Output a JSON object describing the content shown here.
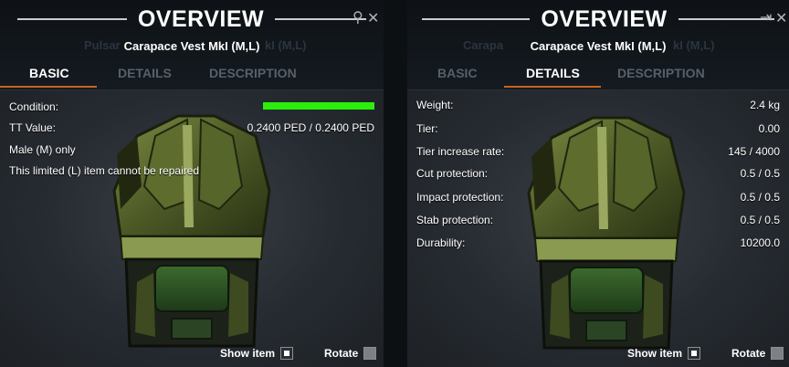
{
  "left_window": {
    "title": "OVERVIEW",
    "subtitle": "Carapace Vest MkI (M,L)",
    "ghost_subtitle": "Pulsar",
    "ghost_subtitle_right": "kI (M,L)",
    "controls": {
      "pin_icon": "pin-icon",
      "close_icon": "close-icon",
      "close_glyph": "✕",
      "pin_glyph": "⚲"
    },
    "tabs": [
      {
        "label": "BASIC",
        "active": true
      },
      {
        "label": "DETAILS",
        "active": false
      },
      {
        "label": "DESCRIPTION",
        "active": false
      }
    ],
    "rows": [
      {
        "label": "Condition:",
        "value": ""
      },
      {
        "label": "TT Value:",
        "value": "0.2400 PED / 0.2400 PED"
      },
      {
        "label": "Male (M) only",
        "value": ""
      },
      {
        "label": "This limited (L) item cannot be repaired",
        "value": ""
      }
    ],
    "condition_fraction": 1.0,
    "show_item_label": "Show item",
    "rotate_label": "Rotate"
  },
  "right_window": {
    "title": "OVERVIEW",
    "subtitle": "Carapace Vest MkI (M,L)",
    "ghost_subtitle": "Carapa",
    "ghost_subtitle_right": "kI (M,L)",
    "controls": {
      "pin_icon": "pin-sideways-icon",
      "close_icon": "close-icon",
      "close_glyph": "✕",
      "pin_glyph": "⇥"
    },
    "tabs": [
      {
        "label": "BASIC",
        "active": false
      },
      {
        "label": "DETAILS",
        "active": true
      },
      {
        "label": "DESCRIPTION",
        "active": false
      }
    ],
    "rows": [
      {
        "label": "Weight:",
        "value": "2.4 kg"
      },
      {
        "label": "Tier:",
        "value": "0.00"
      },
      {
        "label": "Tier increase rate:",
        "value": "145 / 4000"
      },
      {
        "label": "Cut protection:",
        "value": "0.5 / 0.5"
      },
      {
        "label": "Impact protection:",
        "value": "0.5 / 0.5"
      },
      {
        "label": "Stab protection:",
        "value": "0.5 / 0.5"
      },
      {
        "label": "Durability:",
        "value": "10200.0"
      }
    ],
    "show_item_label": "Show item",
    "rotate_label": "Rotate"
  },
  "colors": {
    "accent_tab_underline": "#c8641e",
    "condition_bar": "#2aef0c",
    "panel_bg": "#1b1f25"
  }
}
